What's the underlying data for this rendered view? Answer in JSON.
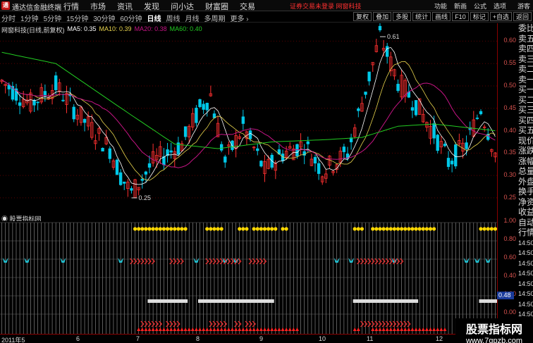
{
  "topbar": {
    "logo_char": "通",
    "title": "通达信金融终端",
    "nav": [
      "行情",
      "市场",
      "资讯",
      "发现",
      "问小达",
      "财富圈",
      "交易"
    ],
    "notice": "证券交易未登录  网窗科技",
    "right": [
      "功能",
      "新画",
      "公式",
      "选项"
    ],
    "guest": "游客"
  },
  "tabs": {
    "left": [
      "分时",
      "1分钟",
      "5分钟",
      "15分钟",
      "30分钟",
      "60分钟",
      "日线",
      "周线",
      "月线",
      "多周期",
      "更多 ›"
    ],
    "active": "日线",
    "right": [
      "复权",
      "叠加",
      "多股",
      "统计",
      "画线",
      "F10",
      "标记",
      "+自选",
      "返回"
    ]
  },
  "main_header": {
    "stock": "网窗科技(日线,前复权)",
    "ma5": "MA5: 0.35",
    "ma10": "MA10: 0.39",
    "ma20": "MA20: 0.38",
    "ma60": "MA60: 0.40"
  },
  "sub_header": "股票指标网",
  "colors": {
    "up": "#ff3030",
    "down": "#00c8e8",
    "ma5": "#ffffff",
    "ma10": "#e8d44d",
    "ma20": "#c71585",
    "ma60": "#22cc22"
  },
  "side_quote": [
    "委比",
    "卖五",
    "卖四",
    "卖三",
    "卖二",
    "卖一",
    "买一",
    "买二",
    "买三",
    "买四",
    "买五",
    "现价",
    "涨跌",
    "涨幅",
    "总量",
    "外盘",
    "换手",
    "净资",
    "收益",
    "自动",
    "行情",
    "14:50",
    "14:50",
    "14:50",
    "14:50",
    "14:50",
    "14:50",
    "14:50",
    "14:50",
    "14:50",
    "14:50"
  ],
  "chart_data": {
    "type": "candlestick",
    "ylim": [
      0.22,
      0.64
    ],
    "yticks": [
      0.6,
      0.55,
      0.5,
      0.45,
      0.4,
      0.35,
      0.3,
      0.25
    ],
    "sub_yticks": [
      1.0,
      0.8,
      0.6,
      0.4,
      0.2,
      0.0
    ],
    "sub_highlight": "0.48",
    "xlabels": [
      "2011年5",
      "6",
      "7",
      "8",
      "9",
      "10",
      "11",
      "12"
    ],
    "annotations": {
      "high": "0.61",
      "low": "0.25"
    }
  },
  "watermark": {
    "line1": "股票指标网",
    "line2": "www.7gpzb.com"
  }
}
